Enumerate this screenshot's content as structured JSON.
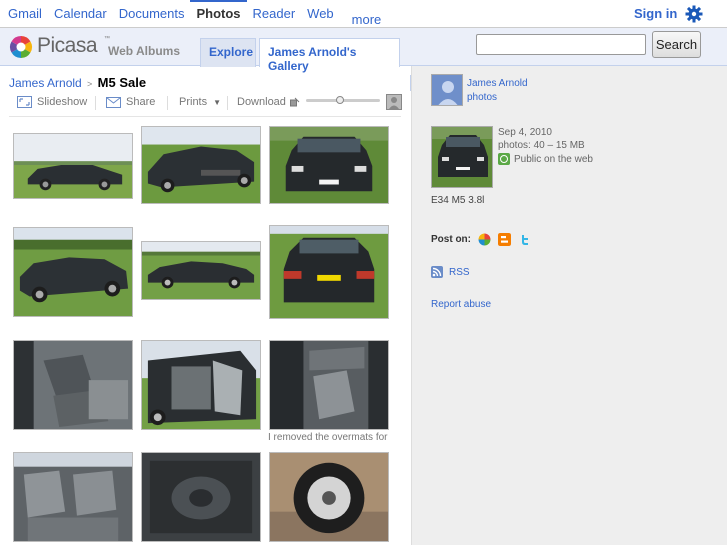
{
  "gbar": {
    "links": [
      "Gmail",
      "Calendar",
      "Documents",
      "Photos",
      "Reader",
      "Web",
      "more"
    ],
    "active": "Photos",
    "signin": "Sign in",
    "settings_icon": "gear-icon"
  },
  "header": {
    "logo_text": "Picasa",
    "logo_tm": "™",
    "logo_sub": "Web Albums",
    "tabs": [
      "Explore",
      "James Arnold's Gallery"
    ],
    "search_value": "",
    "search_button": "Search"
  },
  "album": {
    "owner_link": "James Arnold",
    "separator": ">",
    "title": "M5 Sale",
    "toolbar": {
      "slideshow": "Slideshow",
      "share": "Share",
      "prints": "Prints",
      "download": "Download"
    },
    "zoom_level": 0.45,
    "caption_6": "I removed the overmats for"
  },
  "sidebar": {
    "owner_name": "James Arnold",
    "owner_photos": "photos",
    "date": "Sep 4, 2010",
    "count": "photos: 40 – 15 MB",
    "visibility": "Public on the web",
    "description": "E34 M5 3.8l",
    "post_on": "Post on:",
    "rss": "RSS",
    "report": "Report abuse"
  },
  "colors": {
    "link": "#3366cc",
    "header_bg": "#ebeff9",
    "sidebar_bg": "#eeeeee"
  }
}
